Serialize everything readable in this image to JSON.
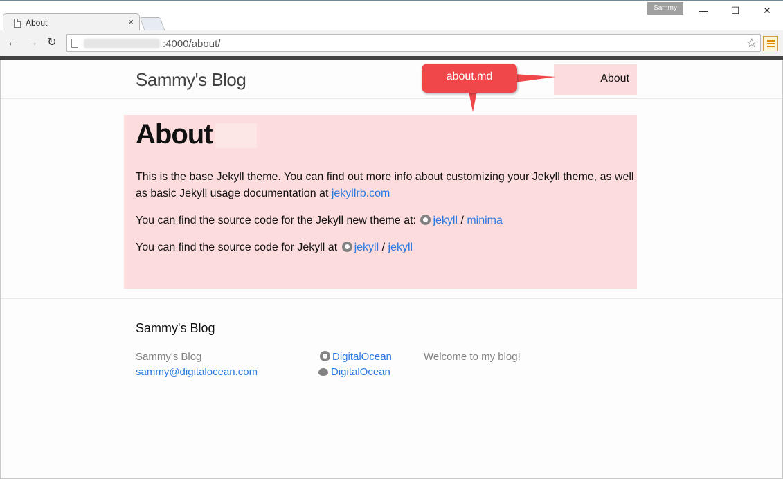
{
  "browser": {
    "tab_title": "About",
    "tab_close": "×",
    "profile_name": "Sammy",
    "url_suffix": ":4000/about/",
    "window": {
      "minimize": "—",
      "maximize": "☐",
      "close": "✕"
    },
    "nav": {
      "back": "←",
      "forward": "→",
      "reload": "↻",
      "star": "☆"
    }
  },
  "site": {
    "title": "Sammy's Blog",
    "nav_about": "About"
  },
  "callout": {
    "text": "about.md",
    "color": "#f0474a"
  },
  "post": {
    "title": "About",
    "p1_text": "This is the base Jekyll theme. You can find out more info about customizing your Jekyll theme, as well as basic Jekyll usage documentation at ",
    "p1_link": "jekyllrb.com",
    "p2_text": "You can find the source code for the Jekyll new theme at:",
    "p2_link1": "jekyll",
    "p2_sep": " / ",
    "p2_link2": "minima",
    "p3_text": "You can find the source code for Jekyll at",
    "p3_link1": "jekyll",
    "p3_sep": " / ",
    "p3_link2": "jekyll"
  },
  "footer": {
    "heading": "Sammy's Blog",
    "name": "Sammy's Blog",
    "email": "sammy@digitalocean.com",
    "github": "DigitalOcean",
    "twitter": "DigitalOcean",
    "description": "Welcome to my blog!"
  },
  "colors": {
    "link": "#2a7ae2",
    "highlight": "#fcdcdc"
  }
}
